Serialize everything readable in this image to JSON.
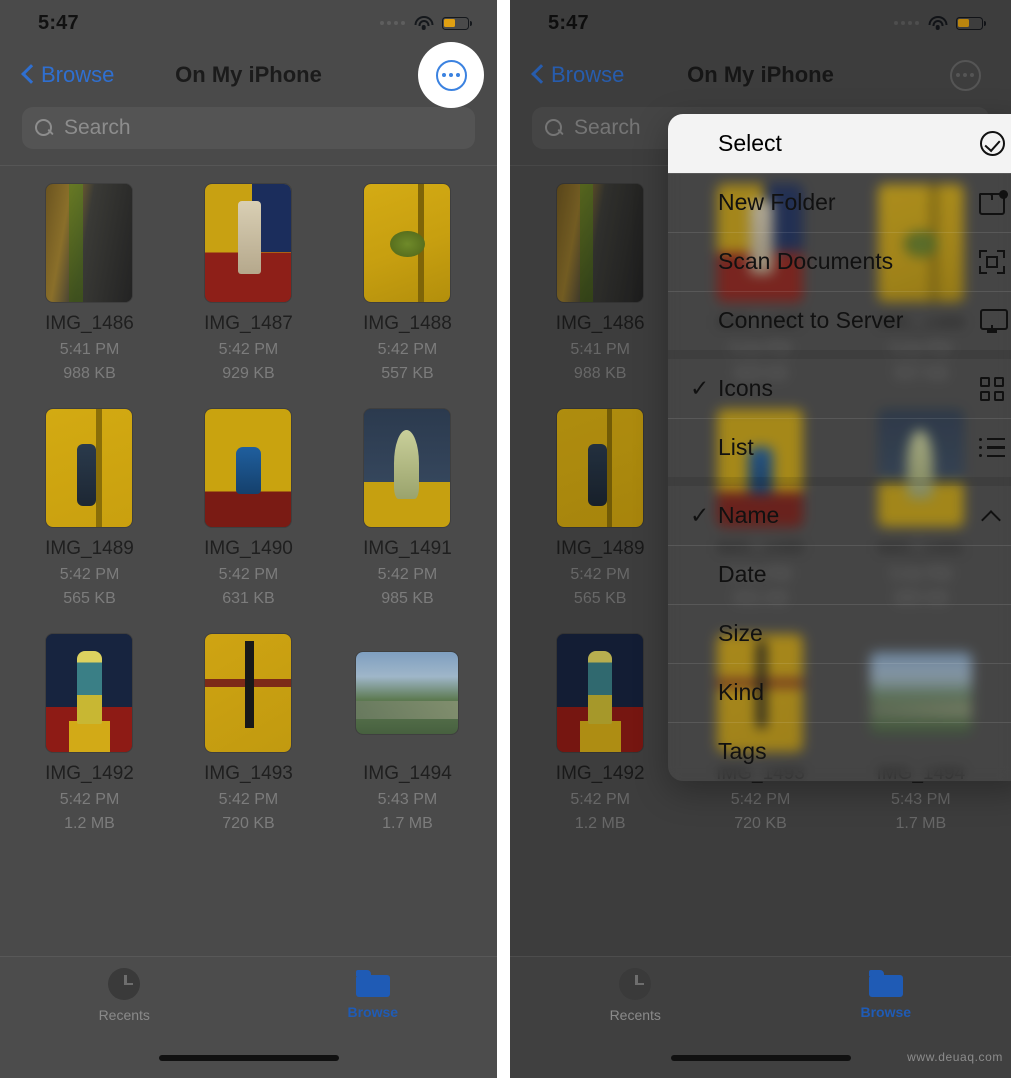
{
  "status_bar": {
    "time": "5:47",
    "cellular_icon": "cellular-dots-icon",
    "wifi_icon": "wifi-icon",
    "battery_icon": "battery-low-power-icon",
    "battery_color": "#e0a012"
  },
  "nav": {
    "back_label": "Browse",
    "title": "On My iPhone",
    "more_icon": "ellipsis-circle-icon",
    "accent_color": "#2f6fd0"
  },
  "search": {
    "placeholder": "Search",
    "icon": "search-icon"
  },
  "files": [
    {
      "name": "IMG_1486",
      "time": "5:41 PM",
      "size": "988 KB",
      "art": "t1",
      "shape": "tall"
    },
    {
      "name": "IMG_1487",
      "time": "5:42 PM",
      "size": "929 KB",
      "art": "t2",
      "shape": "tall"
    },
    {
      "name": "IMG_1488",
      "time": "5:42 PM",
      "size": "557 KB",
      "art": "t3",
      "shape": "tall"
    },
    {
      "name": "IMG_1489",
      "time": "5:42 PM",
      "size": "565 KB",
      "art": "t4",
      "shape": "tall"
    },
    {
      "name": "IMG_1490",
      "time": "5:42 PM",
      "size": "631 KB",
      "art": "t5",
      "shape": "tall"
    },
    {
      "name": "IMG_1491",
      "time": "5:42 PM",
      "size": "985 KB",
      "art": "t6",
      "shape": "tall"
    },
    {
      "name": "IMG_1492",
      "time": "5:42 PM",
      "size": "1.2 MB",
      "art": "t7",
      "shape": "tall"
    },
    {
      "name": "IMG_1493",
      "time": "5:42 PM",
      "size": "720 KB",
      "art": "t8",
      "shape": "tall"
    },
    {
      "name": "IMG_1494",
      "time": "5:43 PM",
      "size": "1.7 MB",
      "art": "t9",
      "shape": "wide"
    }
  ],
  "tabbar": {
    "recents_label": "Recents",
    "recents_icon": "clock-icon",
    "browse_label": "Browse",
    "browse_icon": "folder-icon",
    "active_color": "#1f5bb5"
  },
  "context_menu": {
    "groups": [
      {
        "items": [
          {
            "label": "Select",
            "icon": "check-circle-icon",
            "checked": false,
            "highlighted": true
          },
          {
            "label": "New Folder",
            "icon": "new-folder-icon",
            "checked": false,
            "highlighted": false
          },
          {
            "label": "Scan Documents",
            "icon": "scan-documents-icon",
            "checked": false,
            "highlighted": false
          },
          {
            "label": "Connect to Server",
            "icon": "server-icon",
            "checked": false,
            "highlighted": false
          }
        ]
      },
      {
        "items": [
          {
            "label": "Icons",
            "icon": "grid-view-icon",
            "checked": true,
            "highlighted": false
          },
          {
            "label": "List",
            "icon": "list-view-icon",
            "checked": false,
            "highlighted": false
          }
        ]
      },
      {
        "items": [
          {
            "label": "Name",
            "icon": "chevron-up-icon",
            "checked": true,
            "highlighted": false
          },
          {
            "label": "Date",
            "icon": "",
            "checked": false,
            "highlighted": false
          },
          {
            "label": "Size",
            "icon": "",
            "checked": false,
            "highlighted": false
          },
          {
            "label": "Kind",
            "icon": "",
            "checked": false,
            "highlighted": false
          },
          {
            "label": "Tags",
            "icon": "",
            "checked": false,
            "highlighted": false
          }
        ]
      }
    ],
    "check_glyph": "✓"
  },
  "watermark": "www.deuaq.com"
}
